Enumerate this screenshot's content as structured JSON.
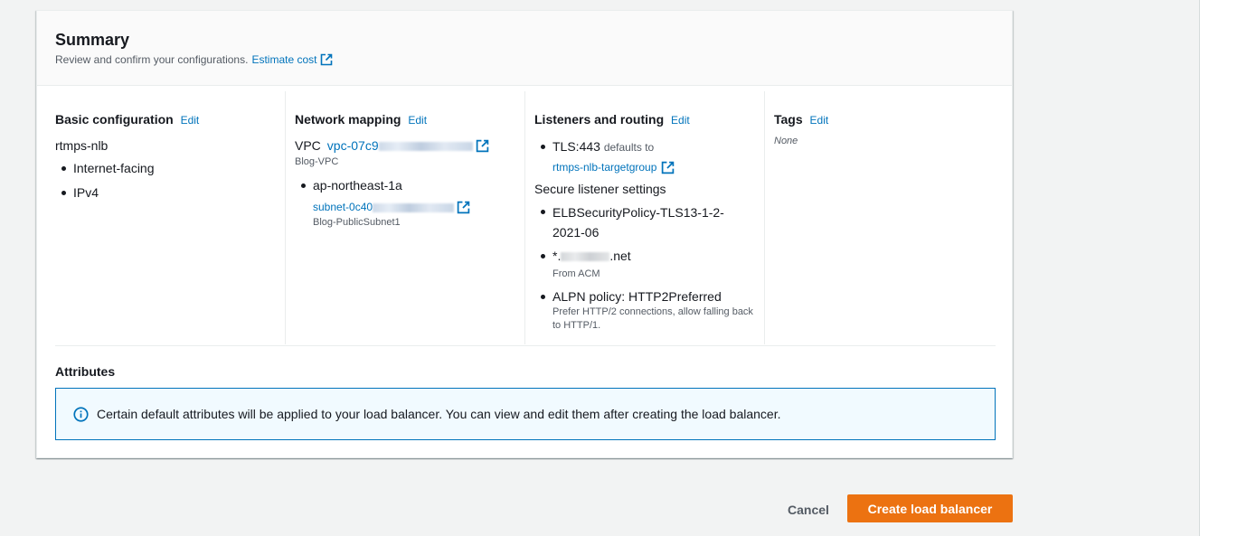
{
  "summary": {
    "title": "Summary",
    "description": "Review and confirm your configurations.",
    "estimate_link": "Estimate cost"
  },
  "basic": {
    "heading": "Basic configuration",
    "edit": "Edit",
    "name": "rtmps-nlb",
    "items": [
      "Internet-facing",
      "IPv4"
    ]
  },
  "network": {
    "heading": "Network mapping",
    "edit": "Edit",
    "vpc_label": "VPC",
    "vpc_id": "vpc-07c9",
    "vpc_name": "Blog-VPC",
    "az": "ap-northeast-1a",
    "subnet_id": "subnet-0c40",
    "subnet_name": "Blog-PublicSubnet1"
  },
  "listeners": {
    "heading": "Listeners and routing",
    "edit": "Edit",
    "listener": "TLS:443",
    "defaults_to": "defaults to",
    "target_group": "rtmps-nlb-targetgroup",
    "secure_heading": "Secure listener settings",
    "policy": "ELBSecurityPolicy-TLS13-1-2-2021-06",
    "cert_prefix": "*.",
    "cert_suffix": ".net",
    "cert_source": "From ACM",
    "alpn": "ALPN policy: HTTP2Preferred",
    "alpn_desc": "Prefer HTTP/2 connections, allow falling back to HTTP/1."
  },
  "tags": {
    "heading": "Tags",
    "edit": "Edit",
    "value": "None"
  },
  "attributes": {
    "heading": "Attributes",
    "info": "Certain default attributes will be applied to your load balancer. You can view and edit them after creating the load balancer."
  },
  "actions": {
    "cancel": "Cancel",
    "create": "Create load balancer"
  },
  "colors": {
    "primary_button": "#ec7211",
    "link": "#0073bb",
    "info_border": "#0073bb"
  }
}
